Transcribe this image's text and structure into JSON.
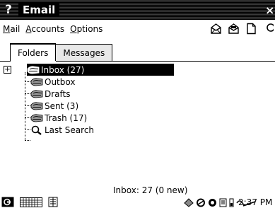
{
  "window": {
    "title": "Email",
    "help_glyph": "?",
    "close_glyph": "×"
  },
  "menu": {
    "mail": {
      "underline": "M",
      "rest": "ail"
    },
    "accounts": {
      "underline": "A",
      "rest": "ccounts"
    },
    "options": {
      "underline": "O",
      "rest": "ptions"
    }
  },
  "toolbar_icons": [
    "envelope-open-icon",
    "envelope-read-icon",
    "new-document-icon",
    "search-icon"
  ],
  "tabs": [
    {
      "label": "Folders",
      "active": true
    },
    {
      "label": "Messages",
      "active": false
    }
  ],
  "folders": [
    {
      "name": "Inbox (27)",
      "icon": "mailbox-icon",
      "selected": true,
      "expander": "+"
    },
    {
      "name": "Outbox",
      "icon": "mailbox-icon",
      "selected": false
    },
    {
      "name": "Drafts",
      "icon": "mailbox-icon",
      "selected": false
    },
    {
      "name": "Sent (3)",
      "icon": "mailbox-icon",
      "selected": false
    },
    {
      "name": "Trash (17)",
      "icon": "mailbox-icon",
      "selected": false
    },
    {
      "name": "Last Search",
      "icon": "magnifier-icon",
      "selected": false
    }
  ],
  "status": {
    "text": "Inbox: 27 (0 new)"
  },
  "taskbar": {
    "clock": "2:37 PM"
  }
}
